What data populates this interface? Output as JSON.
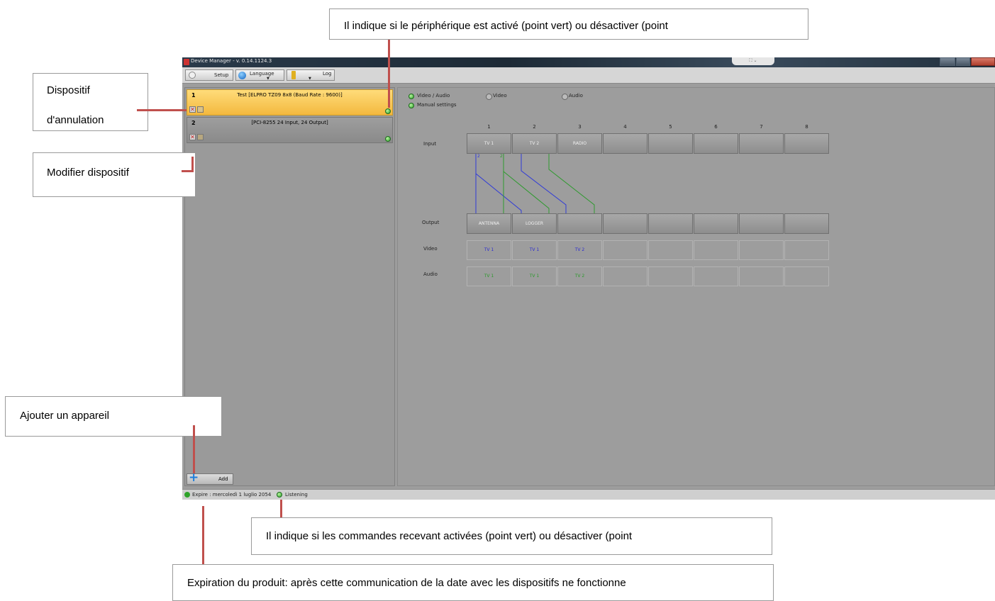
{
  "window": {
    "title": "Device Manager - v. 0.14.1124.3"
  },
  "toolbar": {
    "setup": "Setup",
    "language": "Language",
    "log": "Log"
  },
  "devices": [
    {
      "number": "1",
      "name": "Test [ELPRO TZ09 8x8 (Baud Rate : 9600)]",
      "selected": true
    },
    {
      "number": "2",
      "name": "[PCI-8255 24 Input, 24 Output]",
      "selected": false
    }
  ],
  "add_label": "Add",
  "options": {
    "video_audio": "Video / Audio",
    "video": "Video",
    "audio": "Audio",
    "manual": "Manual settings"
  },
  "matrix": {
    "columns": [
      "1",
      "2",
      "3",
      "4",
      "5",
      "6",
      "7",
      "8"
    ],
    "row_labels": {
      "input": "Input",
      "output": "Output",
      "video": "Video",
      "audio": "Audio"
    },
    "inputs": [
      "TV 1",
      "TV 2",
      "RADIO",
      "",
      "",
      "",
      "",
      ""
    ],
    "outputs": [
      "ANTENNA",
      "LOGGER",
      "",
      "",
      "",
      "",
      "",
      ""
    ],
    "video": [
      "TV 1",
      "TV 1",
      "TV 2",
      "",
      "",
      "",
      "",
      ""
    ],
    "audio": [
      "TV 1",
      "TV 1",
      "TV 2",
      "",
      "",
      "",
      "",
      ""
    ],
    "line_tags": [
      "2",
      "2"
    ]
  },
  "status": {
    "expire": "Expire : mercoledì 1 luglio 2054",
    "listening": "Listening"
  },
  "annotations": {
    "top": "Il indique si le périphérique est activé (point vert) ou désactiver (point",
    "cancel": "Dispositif\nd'annulation",
    "cancel_line1": "Dispositif",
    "cancel_line2": "d'annulation",
    "modify": "Modifier dispositif",
    "add": "Ajouter un appareil",
    "listening": "Il indique si les commandes recevant activées (point vert) ou désactiver (point",
    "expire": "Expiration du produit: après cette communication de la date avec les dispositifs ne fonctionne"
  },
  "colors": {
    "selected_device": "#f7c85a",
    "video_text": "#2a2ad0",
    "audio_text": "#2a9a2a",
    "annotation_line": "#c0504d"
  }
}
